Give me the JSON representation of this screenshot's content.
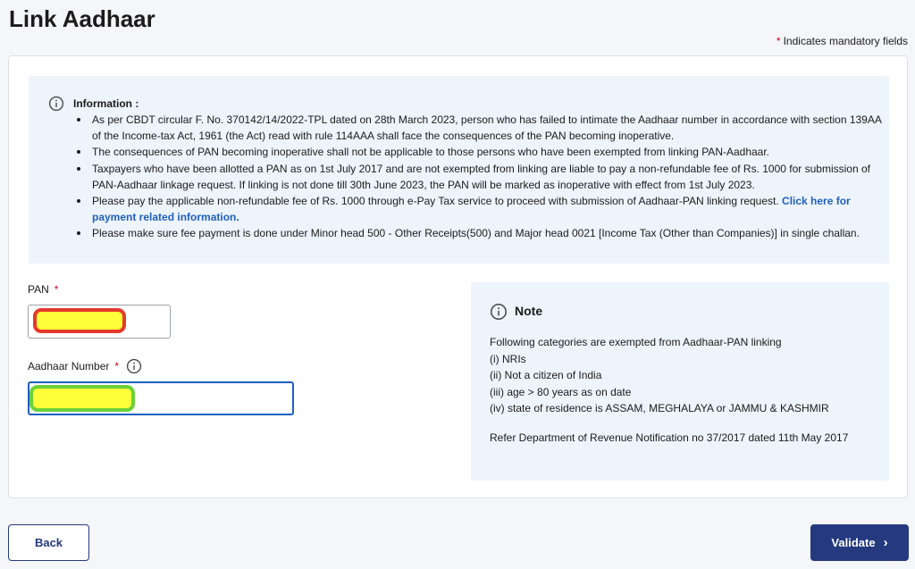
{
  "page": {
    "title": "Link Aadhaar",
    "mandatory_star": "*",
    "mandatory_note": "Indicates mandatory fields"
  },
  "information": {
    "title": "Information :",
    "items": [
      "As per CBDT circular F. No. 370142/14/2022-TPL dated on 28th March 2023, person who has failed to intimate the Aadhaar number in accordance with section 139AA of the Income-tax Act, 1961 (the Act) read with rule 114AAA shall face the consequences of the PAN becoming inoperative.",
      "The consequences of PAN becoming inoperative shall not be applicable to those persons who have been exempted from linking PAN-Aadhaar.",
      "Taxpayers who have been allotted a PAN as on 1st July 2017 and are not exempted from linking are liable to pay a non-refundable fee of Rs. 1000 for submission of PAN-Aadhaar linkage request. If linking is not done till 30th June 2023, the PAN will be marked as inoperative with effect from 1st July 2023.",
      "Please pay the applicable non-refundable fee of Rs. 1000 through e-Pay Tax service to proceed with submission of Aadhaar-PAN linking request.",
      "Please make sure fee payment is done under Minor head 500 - Other Receipts(500) and Major head 0021 [Income Tax (Other than Companies)] in single challan."
    ],
    "link_text": "Click here for payment related information."
  },
  "form": {
    "pan_label": "PAN",
    "aadhaar_label": "Aadhaar Number",
    "required_star": "*"
  },
  "note": {
    "title": "Note",
    "intro": "Following categories are exempted from Aadhaar-PAN linking",
    "items": [
      "(i) NRIs",
      "(ii) Not a citizen of India",
      "(iii) age > 80 years as on date",
      "(iv) state of residence is ASSAM, MEGHALAYA or JAMMU & KASHMIR"
    ],
    "reference": "Refer Department of Revenue Notification no 37/2017 dated 11th May 2017"
  },
  "buttons": {
    "back": "Back",
    "validate": "Validate",
    "validate_icon": "›"
  },
  "colors": {
    "primary": "#24397e",
    "link": "#1f5fbf",
    "required": "#d0021b",
    "info_bg": "#eef4fc",
    "pan_redaction_border": "#e43a2b",
    "aadhaar_redaction_border": "#6bd13a",
    "redaction_fill": "#ffff3a"
  },
  "icons": {
    "information": "info-circle-icon",
    "note": "info-circle-icon",
    "aadhaar_help": "info-circle-icon",
    "validate": "chevron-right-icon"
  }
}
